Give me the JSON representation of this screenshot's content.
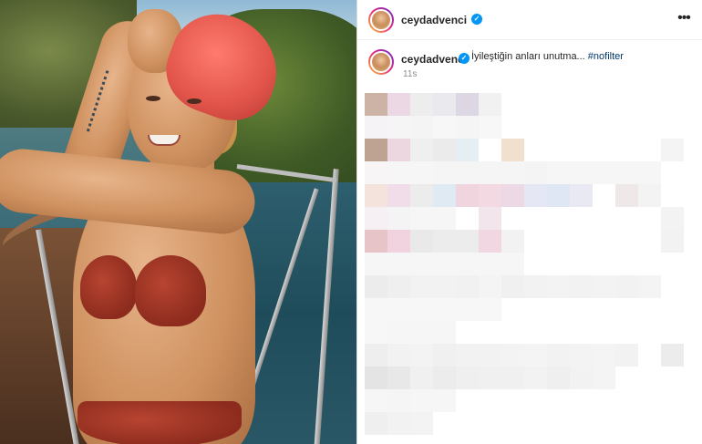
{
  "post": {
    "header": {
      "username": "ceydadvenci",
      "verified": true,
      "more_icon": "more-horizontal-icon"
    },
    "caption": {
      "username": "ceydadvenci",
      "text": "İyileştiğin anları unutma...",
      "hashtag": "#nofilter"
    },
    "timestamp": "11s",
    "comments_blurred": true
  },
  "colors": {
    "verified": "#0095f6",
    "hashtag": "#00376b",
    "scarf": "#e1544a",
    "bikini": "#8d2c1e"
  }
}
